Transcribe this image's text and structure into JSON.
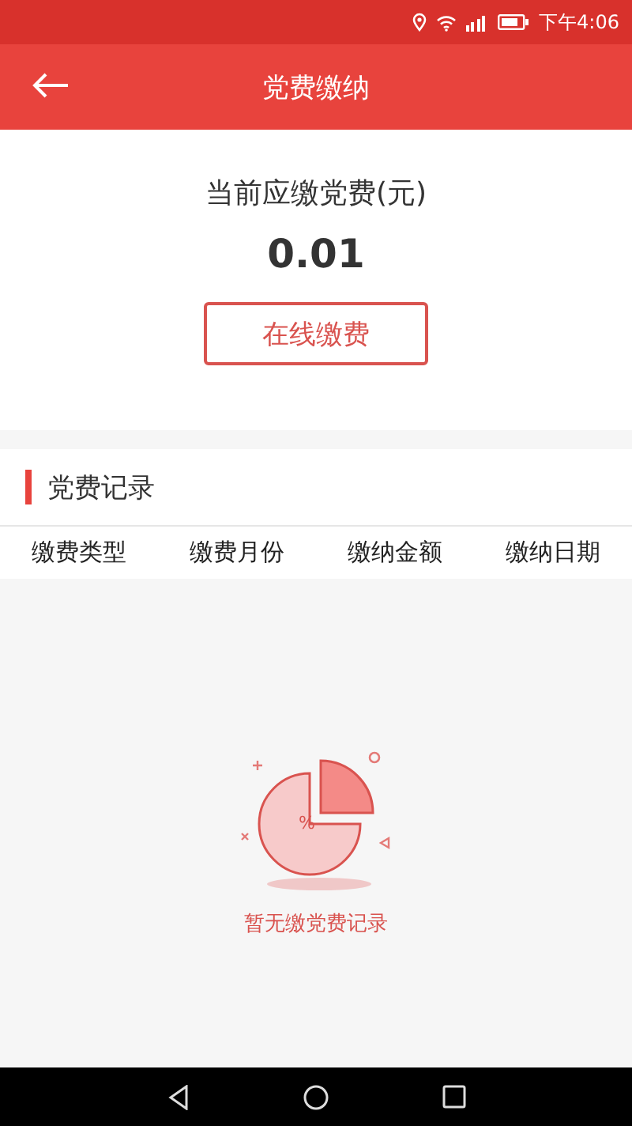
{
  "status_bar": {
    "time": "下午4:06"
  },
  "header": {
    "title": "党费缴纳"
  },
  "due": {
    "label": "当前应缴党费(元)",
    "amount": "0.01",
    "button": "在线缴费"
  },
  "records": {
    "title": "党费记录",
    "columns": [
      "缴费类型",
      "缴费月份",
      "缴纳金额",
      "缴纳日期"
    ]
  },
  "empty_state": {
    "illustration_label": "%",
    "message": "暂无缴党费记录"
  }
}
